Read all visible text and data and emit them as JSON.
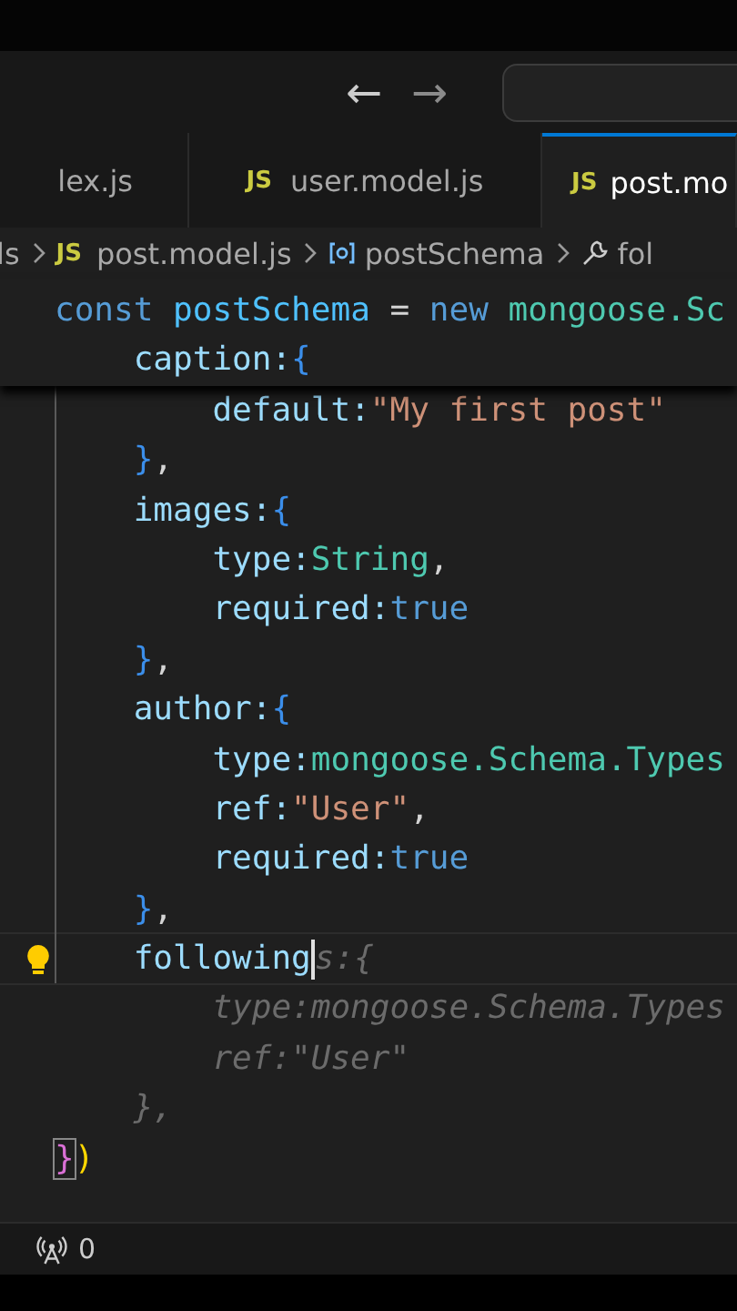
{
  "title_bar": {
    "back": "←",
    "forward": "→"
  },
  "tabs": [
    {
      "label": "lex.js",
      "selected": false
    },
    {
      "label": "user.model.js",
      "icon": "JS",
      "selected": false
    },
    {
      "label": "post.mo",
      "icon": "JS",
      "selected": true
    }
  ],
  "breadcrumb": [
    {
      "kind": "folder",
      "label": "ls"
    },
    {
      "kind": "file",
      "icon": "JS",
      "label": "post.model.js"
    },
    {
      "kind": "variable",
      "label": "postSchema"
    },
    {
      "kind": "property",
      "label": "fol"
    }
  ],
  "sticky_lines": [
    {
      "tokens": [
        {
          "t": "const ",
          "kind": "keyword"
        },
        {
          "t": "postSchema",
          "kind": "var"
        },
        {
          "t": " = ",
          "kind": "op"
        },
        {
          "t": "new ",
          "kind": "keyword"
        },
        {
          "t": "mongoose.Sc",
          "kind": "type"
        }
      ]
    },
    {
      "tokens": [
        {
          "t": "    caption:",
          "kind": "prop"
        },
        {
          "t": "{",
          "kind": "brace"
        }
      ]
    }
  ],
  "lines": [
    {
      "tokens": [
        {
          "t": "        default:",
          "kind": "prop"
        },
        {
          "t": "\"My first post\"",
          "kind": "string"
        }
      ]
    },
    {
      "tokens": [
        {
          "t": "    }",
          "kind": "brace"
        },
        {
          "t": ",",
          "kind": "op"
        }
      ]
    },
    {
      "tokens": [
        {
          "t": "    images:",
          "kind": "prop"
        },
        {
          "t": "{",
          "kind": "brace"
        }
      ]
    },
    {
      "tokens": [
        {
          "t": "        type:",
          "kind": "prop"
        },
        {
          "t": "String",
          "kind": "type"
        },
        {
          "t": ",",
          "kind": "op"
        }
      ]
    },
    {
      "tokens": [
        {
          "t": "        required:",
          "kind": "prop"
        },
        {
          "t": "true",
          "kind": "bool"
        }
      ]
    },
    {
      "tokens": [
        {
          "t": "    }",
          "kind": "brace"
        },
        {
          "t": ",",
          "kind": "op"
        }
      ]
    },
    {
      "tokens": [
        {
          "t": "    author:",
          "kind": "prop"
        },
        {
          "t": "{",
          "kind": "brace"
        }
      ]
    },
    {
      "tokens": [
        {
          "t": "        type:",
          "kind": "prop"
        },
        {
          "t": "mongoose.Schema.Types",
          "kind": "type"
        }
      ]
    },
    {
      "tokens": [
        {
          "t": "        ref:",
          "kind": "prop"
        },
        {
          "t": "\"User\"",
          "kind": "string"
        },
        {
          "t": ",",
          "kind": "op"
        }
      ]
    },
    {
      "tokens": [
        {
          "t": "        required:",
          "kind": "prop"
        },
        {
          "t": "true",
          "kind": "bool"
        }
      ]
    },
    {
      "tokens": [
        {
          "t": "    }",
          "kind": "brace"
        },
        {
          "t": ",",
          "kind": "op"
        }
      ]
    },
    {
      "lightbulb": true,
      "current": true,
      "tokens": [
        {
          "t": "    following",
          "kind": "prop",
          "cursor": true
        },
        {
          "t": "s:{",
          "kind": "ghost"
        }
      ]
    },
    {
      "tokens": [
        {
          "t": "        type:mongoose.Schema.Types",
          "kind": "ghost"
        }
      ]
    },
    {
      "tokens": [
        {
          "t": "        ref:\"User\"",
          "kind": "ghost"
        }
      ]
    },
    {
      "tokens": [
        {
          "t": "    },",
          "kind": "ghost"
        }
      ]
    },
    {
      "tokens": [
        {
          "t": "}",
          "kind": "match"
        },
        {
          "t": ")",
          "kind": "paren"
        }
      ]
    }
  ],
  "status_bar": {
    "ports": "0"
  }
}
